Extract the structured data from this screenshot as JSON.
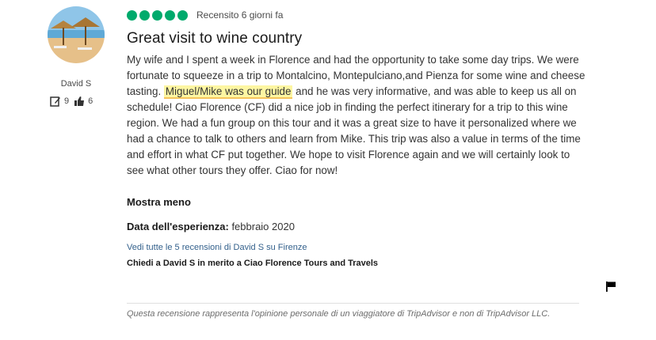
{
  "reviewer": {
    "name": "David S",
    "contributions": "9",
    "helpful_votes": "6"
  },
  "review": {
    "rating": 5,
    "rating_color": "#00aa6c",
    "date_label": "Recensito 6 giorni fa",
    "title": "Great visit to wine country",
    "text_part1": "My wife and I spent a week in Florence and had the opportunity to take some day trips. We were fortunate to squeeze in a trip to Montalcino, Montepulciano,and Pienza for some wine and cheese tasting. ",
    "text_highlight": "Miguel/Mike was our guide",
    "text_part2": " and he was very informative, and was able to keep us all on schedule! Ciao Florence (CF) did a nice job in finding the perfect itinerary for a trip to this wine region. We had a fun group on this tour and it was a great size to have it personalized where we had a chance to talk to others and learn from Mike. This trip was also a value in terms of the time and effort in what CF put together. We hope to visit Florence again and we will certainly look to see what other tours they offer. Ciao for now!",
    "show_less": "Mostra meno",
    "experience_label": "Data dell'esperienza:",
    "experience_date": "febbraio 2020",
    "all_reviews_link": "Vedi tutte le 5 recensioni di David S su Firenze",
    "ask_link": "Chiedi a David S in merito a Ciao Florence Tours and Travels",
    "disclaimer": "Questa recensione rappresenta l'opinione personale di un viaggiatore di TripAdvisor e non di TripAdvisor LLC."
  }
}
